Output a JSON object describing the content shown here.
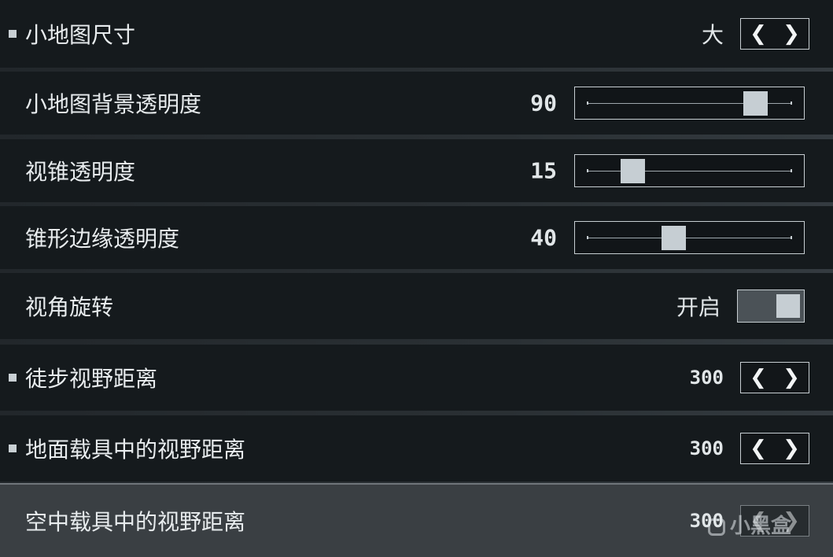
{
  "settings": [
    {
      "label": "小地图尺寸",
      "control": "stepper",
      "value": "大",
      "bullet": true
    },
    {
      "label": "小地图背景透明度",
      "control": "slider",
      "value": "90",
      "fraction": 0.9
    },
    {
      "label": "视锥透明度",
      "control": "slider",
      "value": "15",
      "fraction": 0.15
    },
    {
      "label": "锥形边缘透明度",
      "control": "slider",
      "value": "40",
      "fraction": 0.4
    },
    {
      "label": "视角旋转",
      "control": "toggle",
      "value": "开启",
      "on": true
    },
    {
      "label": "徒步视野距离",
      "control": "stepper",
      "value": "300",
      "bullet": true
    },
    {
      "label": "地面载具中的视野距离",
      "control": "stepper",
      "value": "300",
      "bullet": true
    },
    {
      "label": "空中载具中的视野距离",
      "control": "stepper",
      "value": "300",
      "selected": true
    }
  ],
  "icons": {
    "decrement": "chevron-left-icon",
    "increment": "chevron-right-icon",
    "bullet": "square-bullet-icon"
  },
  "colors": {
    "row_background": "#151a1d",
    "selected_row_background": "#3a3f43",
    "slider_thumb": "#c6ced3",
    "text": "#e8ecee"
  },
  "watermark": {
    "text": "小黑盒"
  }
}
